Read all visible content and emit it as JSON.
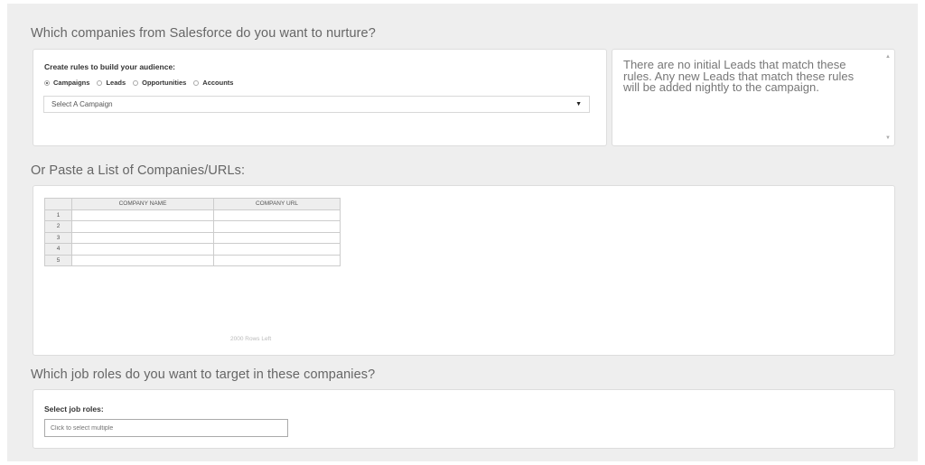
{
  "section1": {
    "title": "Which companies from Salesforce do you want to nurture?",
    "rules_label": "Create rules to build your audience:",
    "options": [
      {
        "label": "Campaigns",
        "checked": true
      },
      {
        "label": "Leads",
        "checked": false
      },
      {
        "label": "Opportunities",
        "checked": false
      },
      {
        "label": "Accounts",
        "checked": false
      }
    ],
    "select_value": "Select A Campaign",
    "select_arrow": "▼",
    "info_text": "There are no initial Leads that match these rules. Any new Leads that match these rules will be added nightly to the campaign.",
    "scroll_up": "▲",
    "scroll_down": "▼"
  },
  "section2": {
    "title": "Or Paste a List of Companies/URLs:",
    "columns": [
      "COMPANY NAME",
      "COMPANY URL"
    ],
    "rows": [
      "1",
      "2",
      "3",
      "4",
      "5"
    ],
    "rows_left": "2000 Rows Left"
  },
  "section3": {
    "title": "Which job roles do you want to target in these companies?",
    "label": "Select job roles:",
    "placeholder": "Click to select multiple"
  }
}
